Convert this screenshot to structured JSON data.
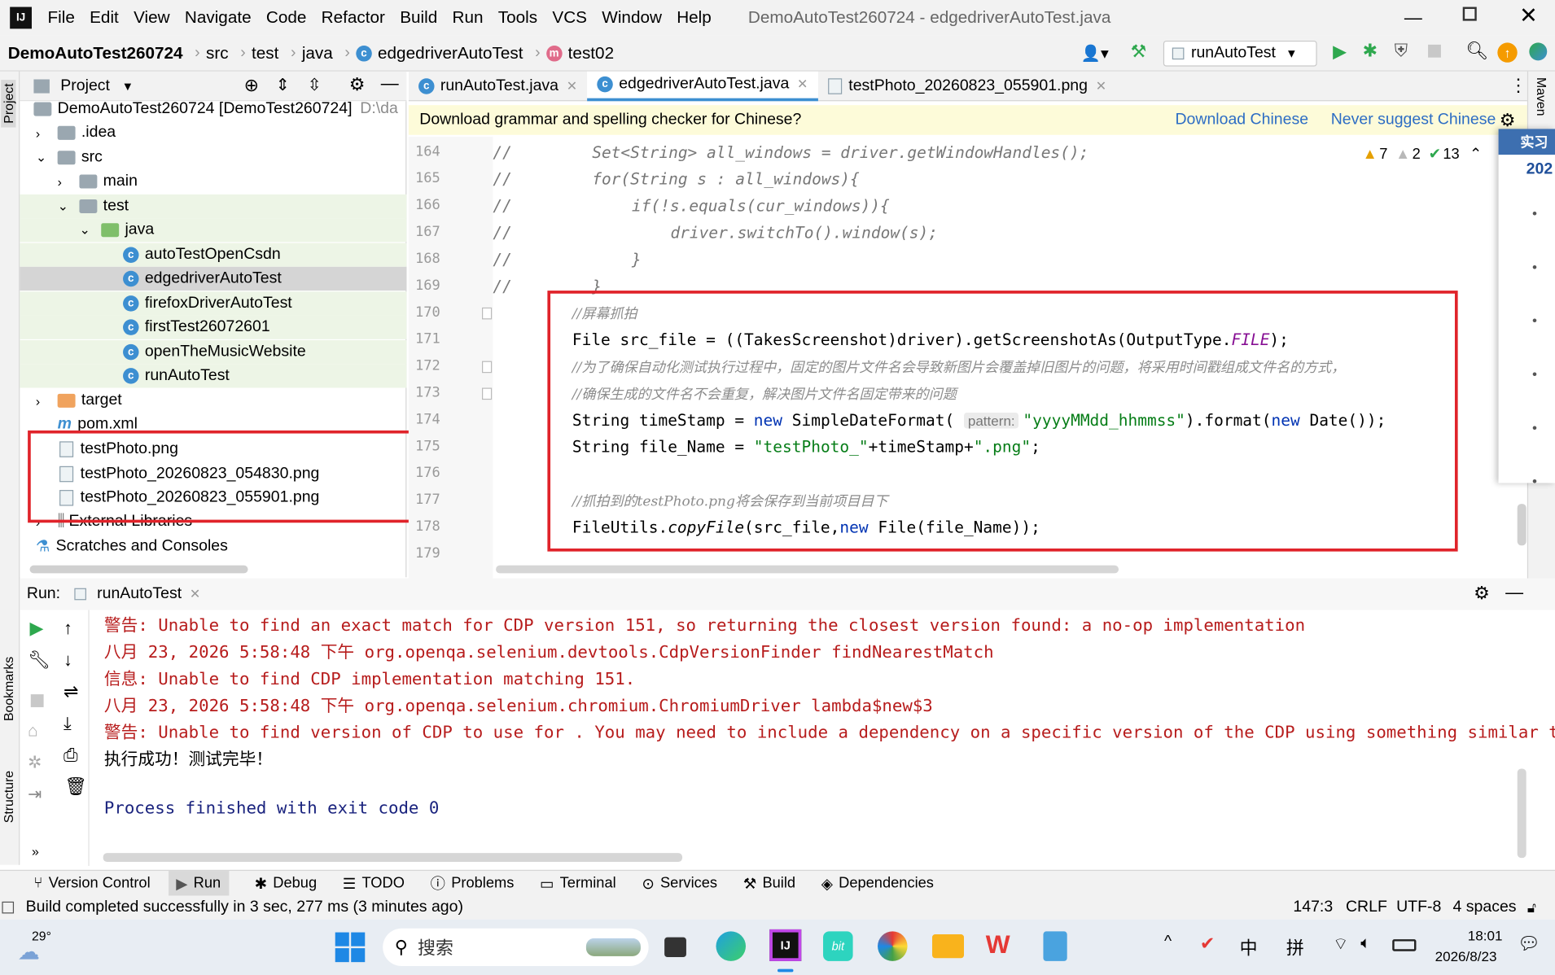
{
  "window": {
    "title": "DemoAutoTest260724 - edgedriverAutoTest.java"
  },
  "menu": [
    "File",
    "Edit",
    "View",
    "Navigate",
    "Code",
    "Refactor",
    "Build",
    "Run",
    "Tools",
    "VCS",
    "Window",
    "Help"
  ],
  "breadcrumb": [
    "DemoAutoTest260724",
    "src",
    "test",
    "java",
    "edgedriverAutoTest",
    "test02"
  ],
  "run_config": "runAutoTest",
  "project_panel": {
    "title": "Project",
    "root": "DemoAutoTest260724 [DemoTest260724]",
    "root_path": "D:\\da",
    "items": [
      {
        "label": ".idea"
      },
      {
        "label": "src"
      },
      {
        "label": "main"
      },
      {
        "label": "test"
      },
      {
        "label": "java"
      },
      {
        "label": "autoTestOpenCsdn"
      },
      {
        "label": "edgedriverAutoTest"
      },
      {
        "label": "firefoxDriverAutoTest"
      },
      {
        "label": "firstTest26072601"
      },
      {
        "label": "openTheMusicWebsite"
      },
      {
        "label": "runAutoTest"
      },
      {
        "label": "target"
      },
      {
        "label": "pom.xml"
      },
      {
        "label": "testPhoto.png"
      },
      {
        "label": "testPhoto_20260823_054830.png"
      },
      {
        "label": "testPhoto_20260823_055901.png"
      },
      {
        "label": "External Libraries"
      },
      {
        "label": "Scratches and Consoles"
      }
    ]
  },
  "editor_tabs": [
    "runAutoTest.java",
    "edgedriverAutoTest.java",
    "testPhoto_20260823_055901.png"
  ],
  "banner": {
    "text": "Download grammar and spelling checker for Chinese?",
    "download": "Download Chinese",
    "never": "Never suggest Chinese"
  },
  "inspections": {
    "warnings": "7",
    "weak": "2",
    "ok": "13"
  },
  "line_numbers": [
    "164",
    "165",
    "166",
    "167",
    "168",
    "169",
    "170",
    "171",
    "172",
    "173",
    "174",
    "175",
    "176",
    "177",
    "178",
    "179"
  ],
  "code": {
    "l164": "Set<String> all_windows = driver.getWindowHandles();",
    "l165": "for(String s : all_windows){",
    "l166": "if(!s.equals(cur_windows)){",
    "l167": "driver.switchTo().window(s);",
    "l168": "}",
    "l169": "}",
    "slash": "//",
    "c170": "//屏幕抓拍",
    "l171a": "File src_file = ((TakesScreenshot)driver).getScreenshotAs(OutputType.",
    "l171b": "FILE",
    "l171c": ");",
    "c172": "//为了确保自动化测试执行过程中，固定的图片文件名会导致新图片会覆盖掉旧图片的问题，将采用时间戳组成文件名的方式，",
    "c173": "//确保生成的文件名不会重复，解决图片文件名固定带来的问题",
    "l174a": "String timeStamp = ",
    "l174new": "new",
    "l174b": " SimpleDateFormat( ",
    "l174hint": "pattern:",
    "l174str": "\"yyyyMMdd_hhmmss\"",
    "l174c": ").format(",
    "l174new2": "new",
    "l174d": " Date());",
    "l175a": "String file_Name = ",
    "l175str1": "\"testPhoto_\"",
    "l175b": "+timeStamp+",
    "l175str2": "\".png\"",
    "l175c": ";",
    "c177": "//抓拍到的testPhoto.png将会保存到当前项目目下",
    "l178a": "FileUtils.",
    "l178b": "copyFile",
    "l178c": "(src_file,",
    "l178new": "new",
    "l178d": " File(file_Name));"
  },
  "run_panel": {
    "label": "Run:",
    "tab": "runAutoTest",
    "lines": [
      "警告: Unable to find an exact match for CDP version 151, so returning the closest version found: a no-op implementation",
      "八月 23, 2026 5:58:48 下午 org.openqa.selenium.devtools.CdpVersionFinder findNearestMatch",
      "信息: Unable to find CDP implementation matching 151.",
      "八月 23, 2026 5:58:48 下午 org.openqa.selenium.chromium.ChromiumDriver lambda$new$3",
      "警告: Unable to find version of CDP to use for . You may need to include a dependency on a specific version of the CDP using something similar to `",
      "执行成功！测试完毕！"
    ],
    "finished": "Process finished with exit code 0"
  },
  "bottom_tabs": [
    "Version Control",
    "Run",
    "Debug",
    "TODO",
    "Problems",
    "Terminal",
    "Services",
    "Build",
    "Dependencies"
  ],
  "side_labels": {
    "project": "Project",
    "bookmarks": "Bookmarks",
    "structure": "Structure",
    "maven": "Maven"
  },
  "status": {
    "message": "Build completed successfully in 3 sec, 277 ms (3 minutes ago)",
    "position": "147:3",
    "eol": "CRLF",
    "encoding": "UTF-8",
    "indent": "4 spaces"
  },
  "popup": {
    "title": "实习",
    "year": "202"
  },
  "taskbar": {
    "temp": "29°",
    "search": "搜索",
    "ime1": "中",
    "ime2": "拼",
    "time": "18:01",
    "date": "2026/8/23"
  },
  "colors": {
    "accent": "#3d8fd1",
    "highlight_box": "#e0232a",
    "run_green": "#2ea84e"
  }
}
